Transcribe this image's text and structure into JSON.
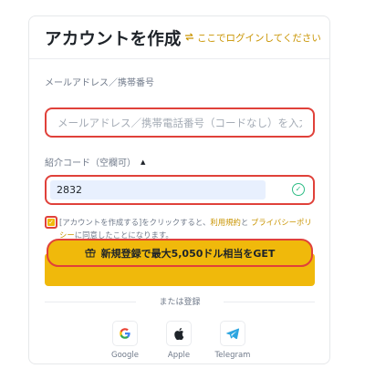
{
  "header": {
    "title": "アカウントを作成",
    "login_link": "ここでログインしてください"
  },
  "email": {
    "label": "メールアドレス／携帯番号",
    "placeholder": "メールアドレス／携帯電話番号（コードなし）を入力"
  },
  "referral": {
    "label": "紹介コード（空欄可）",
    "value": "2832"
  },
  "agreement": {
    "prefix": "[アカウントを作成する]をクリックすると、",
    "terms_link": "利用規約",
    "connector": "と ",
    "privacy_link": "プライバシーポリシー",
    "suffix": "に同意したことになります。"
  },
  "cta": {
    "label": "新規登録で最大5,050ドル相当をGET"
  },
  "divider_text": "または登録",
  "social": [
    {
      "name": "Google",
      "icon": "google-icon"
    },
    {
      "name": "Apple",
      "icon": "apple-icon"
    },
    {
      "name": "Telegram",
      "icon": "telegram-icon"
    }
  ],
  "colors": {
    "accent": "#f0b90b",
    "link": "#c99400",
    "highlight_border": "#e0413a",
    "success": "#2ebd85"
  }
}
